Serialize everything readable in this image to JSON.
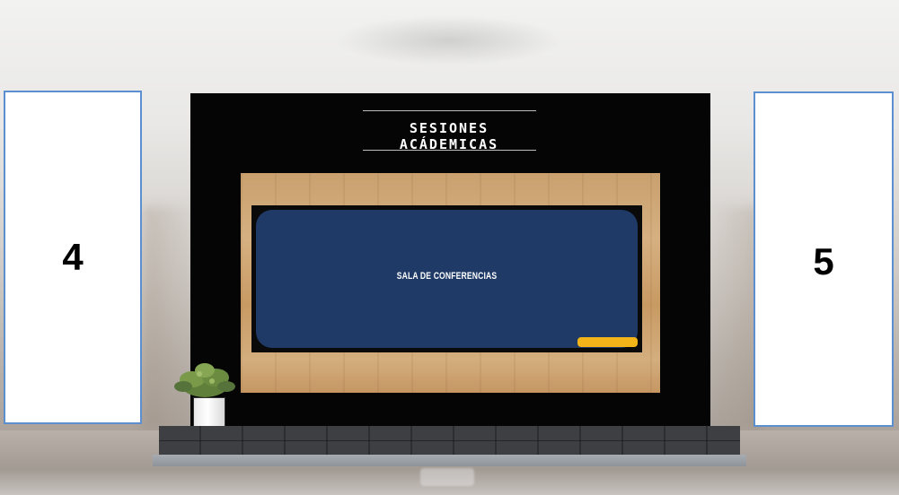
{
  "booth": {
    "title": "SESIONES ACÁDEMICAS",
    "screen_label": "SALA DE CONFERENCIAS",
    "screen_button_label": "",
    "colors": {
      "wall": "#050505",
      "screen": "#1f3a66",
      "button": "#f2b418",
      "panel_border": "#5b8fd0"
    }
  },
  "panels": {
    "left_number": "4",
    "right_number": "5"
  },
  "decor": {
    "plant_icon": "potted-plant-icon"
  }
}
